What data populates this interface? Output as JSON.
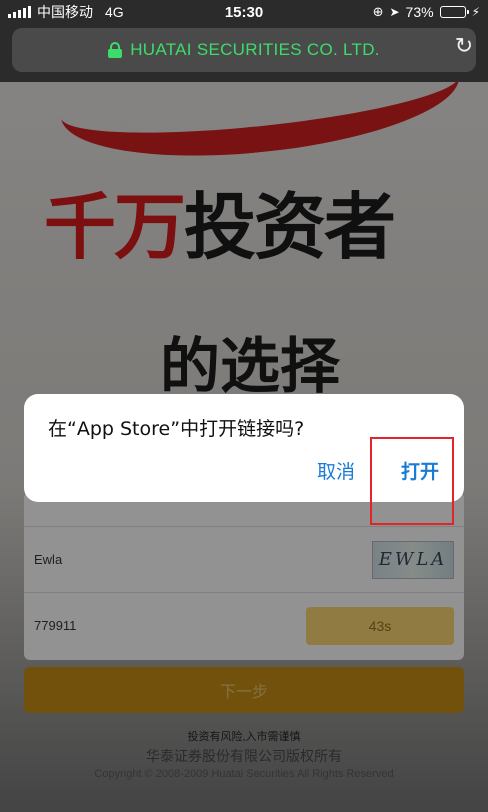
{
  "status_bar": {
    "carrier": "中国移动",
    "network": "4G",
    "time": "15:30",
    "battery": "73%",
    "battery_level": 0.73,
    "battery_color": "#4cd964"
  },
  "browser": {
    "url_text": "HUATAI SECURITIES CO. LTD.",
    "url_color": "#3ddc6a",
    "reload_icon": "reload-icon"
  },
  "page": {
    "hero_line1_red": "千万",
    "hero_line1_black": "投资者",
    "hero_line2": "的选择",
    "captcha_value": "Ewla",
    "captcha_image_text": "EWLA",
    "sms_code_value": "779911",
    "countdown_label": "43s",
    "next_button_label": "下一步",
    "risk_note": "投资有风险,入市需谨慎",
    "company_name": "华泰证券股份有限公司版权所有",
    "copyright": "Copyright © 2008-2009 Huatai Securities All Rights Reserved"
  },
  "dialog": {
    "message": "在“App Store”中打开链接吗?",
    "cancel_label": "取消",
    "open_label": "打开",
    "button_color": "#1a7bd6",
    "highlight_color": "#e0252b"
  }
}
